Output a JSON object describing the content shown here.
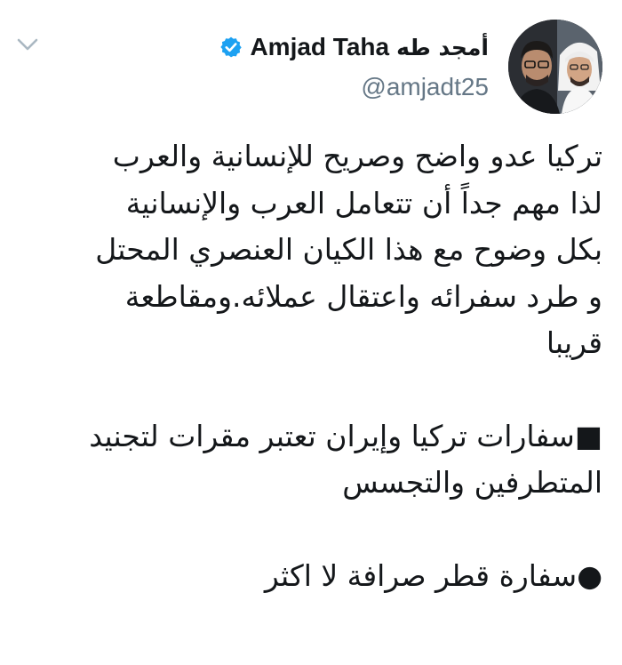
{
  "header": {
    "display_name_arabic": "أمجد طه",
    "display_name_latin": "Amjad Taha",
    "handle": "@amjadt25",
    "verified": true
  },
  "icons": {
    "menu": "chevron-down-icon",
    "verified": "verified-badge-icon",
    "avatar": "avatar-photo"
  },
  "colors": {
    "verified_blue": "#1da1f2",
    "handle_gray": "#657786",
    "chevron_gray": "#aab8c2",
    "text": "#14171a"
  },
  "tweet": {
    "lines": [
      "تركيا عدو واضح وصريح للإنسانية والعرب",
      "لذا مهم جداً أن تتعامل العرب والإنسانية",
      "بكل وضوح مع هذا الكيان العنصري المحتل",
      "و طرد سفرائه واعتقال عملائه.ومقاطعة",
      "قريبا",
      "",
      "■سفارات تركيا وإيران تعتبر مقرات لتجنيد",
      "المتطرفين والتجسس",
      "",
      "●سفارة قطر صرافة لا اكثر"
    ]
  }
}
